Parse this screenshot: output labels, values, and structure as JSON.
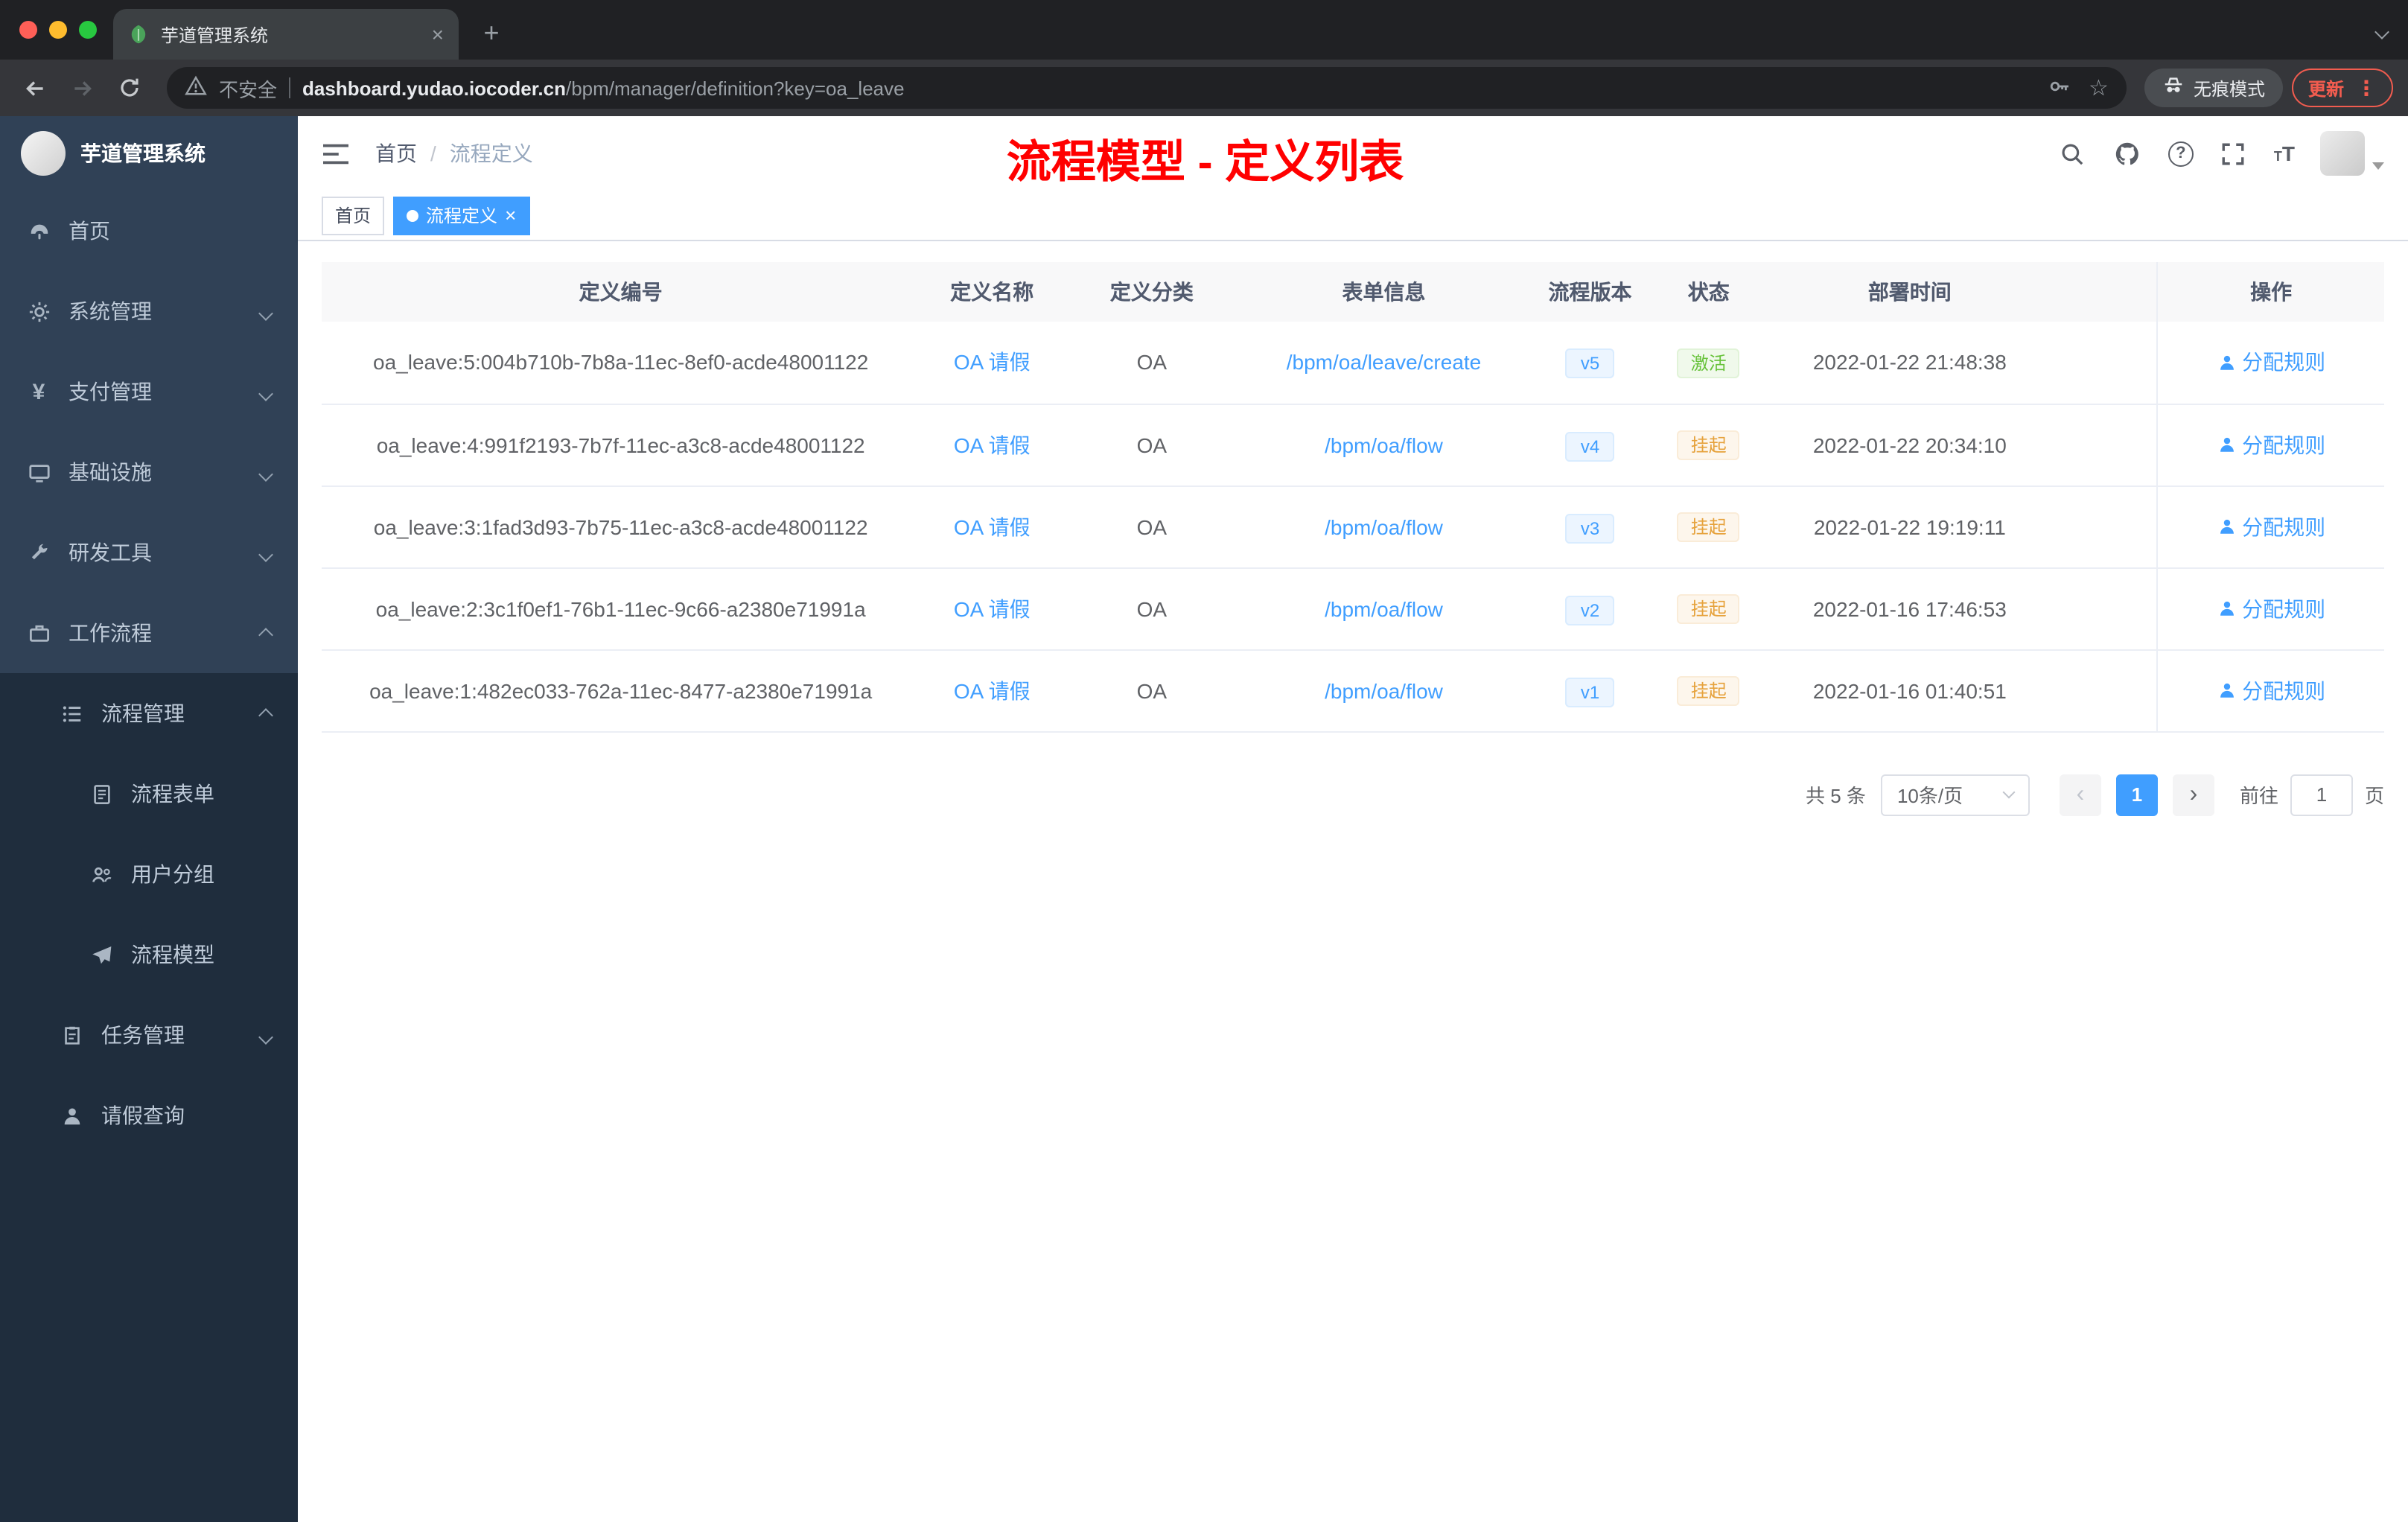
{
  "browser": {
    "tab": {
      "title": "芋道管理系统"
    },
    "toolbar": {
      "security_label": "不安全",
      "url_host": "dashboard.yudao.iocoder.cn",
      "url_path": "/bpm/manager/definition?key=oa_leave",
      "incognito_label": "无痕模式",
      "update_label": "更新"
    }
  },
  "sidebar": {
    "app_title": "芋道管理系统",
    "menu": [
      {
        "label": "首页"
      },
      {
        "label": "系统管理"
      },
      {
        "label": "支付管理"
      },
      {
        "label": "基础设施"
      },
      {
        "label": "研发工具"
      },
      {
        "label": "工作流程"
      },
      {
        "label": "流程管理"
      },
      {
        "label": "流程表单"
      },
      {
        "label": "用户分组"
      },
      {
        "label": "流程模型"
      },
      {
        "label": "任务管理"
      },
      {
        "label": "请假查询"
      }
    ]
  },
  "header": {
    "breadcrumb_home": "首页",
    "breadcrumb_sep": "/",
    "breadcrumb_current": "流程定义",
    "annotation": "流程模型 - 定义列表"
  },
  "tags": {
    "home": "首页",
    "active": "流程定义"
  },
  "table": {
    "columns": {
      "id": "定义编号",
      "name": "定义名称",
      "category": "定义分类",
      "form": "表单信息",
      "version": "流程版本",
      "status": "状态",
      "deploy_time": "部署时间",
      "action": "操作"
    },
    "action_label": "分配规则",
    "rows": [
      {
        "id": "oa_leave:5:004b710b-7b8a-11ec-8ef0-acde48001122",
        "name": "OA 请假",
        "category": "OA",
        "form": "/bpm/oa/leave/create",
        "version": "v5",
        "status": "激活",
        "time": "2022-01-22 21:48:38"
      },
      {
        "id": "oa_leave:4:991f2193-7b7f-11ec-a3c8-acde48001122",
        "name": "OA 请假",
        "category": "OA",
        "form": "/bpm/oa/flow",
        "version": "v4",
        "status": "挂起",
        "time": "2022-01-22 20:34:10"
      },
      {
        "id": "oa_leave:3:1fad3d93-7b75-11ec-a3c8-acde48001122",
        "name": "OA 请假",
        "category": "OA",
        "form": "/bpm/oa/flow",
        "version": "v3",
        "status": "挂起",
        "time": "2022-01-22 19:19:11"
      },
      {
        "id": "oa_leave:2:3c1f0ef1-76b1-11ec-9c66-a2380e71991a",
        "name": "OA 请假",
        "category": "OA",
        "form": "/bpm/oa/flow",
        "version": "v2",
        "status": "挂起",
        "time": "2022-01-16 17:46:53"
      },
      {
        "id": "oa_leave:1:482ec033-762a-11ec-8477-a2380e71991a",
        "name": "OA 请假",
        "category": "OA",
        "form": "/bpm/oa/flow",
        "version": "v1",
        "status": "挂起",
        "time": "2022-01-16 01:40:51"
      }
    ]
  },
  "pagination": {
    "total": "共 5 条",
    "page_size": "10条/页",
    "page": "1",
    "goto_label": "前往",
    "goto_value": "1",
    "unit_label": "页"
  },
  "colors": {
    "accent": "#409eff",
    "status_active": "#67c23a",
    "status_suspended": "#e6a23c",
    "annotation_red": "#ff0000",
    "sidebar_bg": "#304156",
    "submenu_bg": "#1f2d3d"
  }
}
